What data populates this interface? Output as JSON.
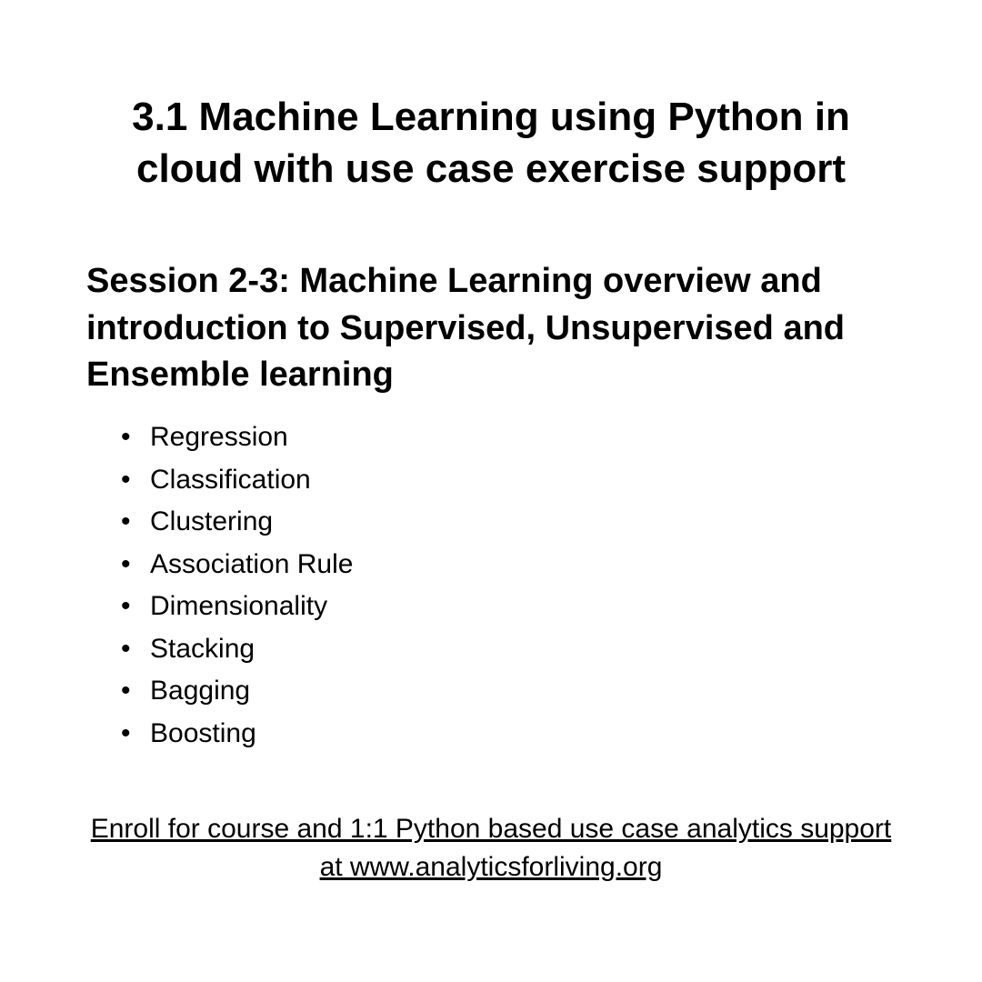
{
  "title": "3.1 Machine Learning using Python in cloud with use case exercise support",
  "session": {
    "heading": "Session 2-3: Machine Learning overview and introduction to Supervised, Unsupervised and Ensemble learning",
    "topics": [
      "Regression",
      "Classification",
      "Clustering",
      "Association Rule",
      "Dimensionality",
      "Stacking",
      "Bagging",
      "Boosting"
    ]
  },
  "footer": {
    "text": "Enroll for course and 1:1 Python based use case analytics support at www.analyticsforliving.org"
  }
}
